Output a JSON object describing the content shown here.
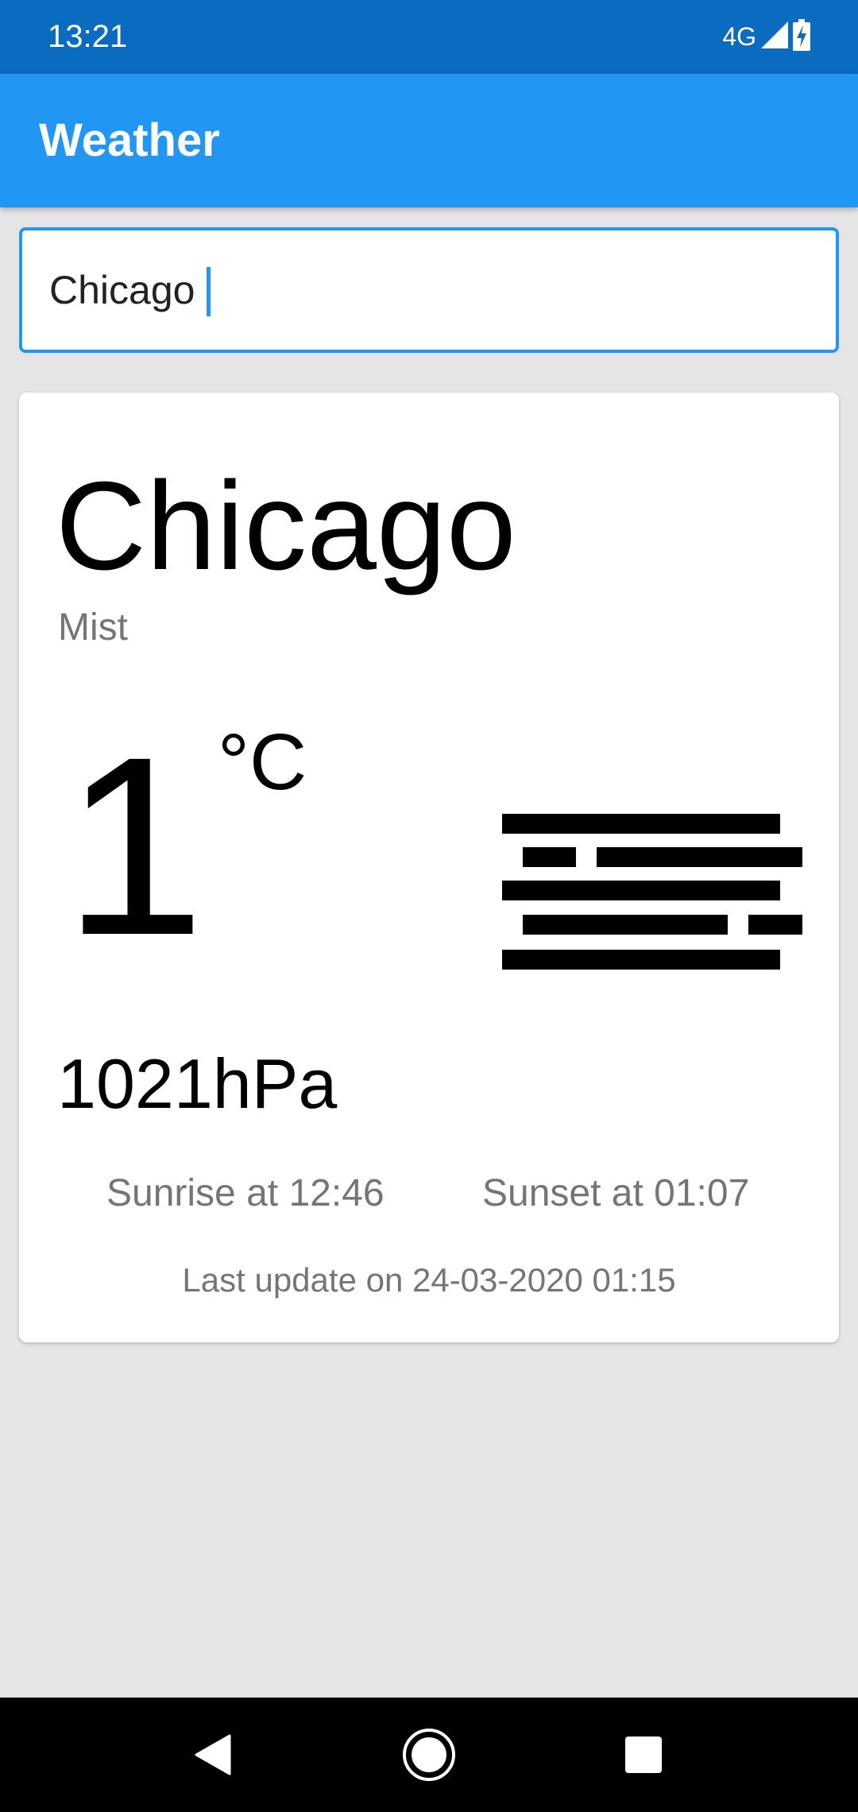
{
  "status_bar": {
    "time": "13:21",
    "network": "4G",
    "icons": [
      "signal-icon",
      "battery-charging-icon"
    ]
  },
  "app_bar": {
    "title": "Weather",
    "color": "#2196f3",
    "status_color": "#0a6bbf"
  },
  "search": {
    "value": "Chicago",
    "placeholder": ""
  },
  "weather": {
    "city": "Chicago",
    "condition": "Mist",
    "temperature": "1",
    "unit": "°C",
    "icon": "mist-icon",
    "pressure": "1021hPa",
    "sunrise": "Sunrise at 12:46",
    "sunset": "Sunset at 01:07",
    "last_update": "Last update on 24-03-2020 01:15"
  },
  "nav_bar": {
    "icons": [
      "back-icon",
      "home-icon",
      "recents-icon"
    ]
  }
}
